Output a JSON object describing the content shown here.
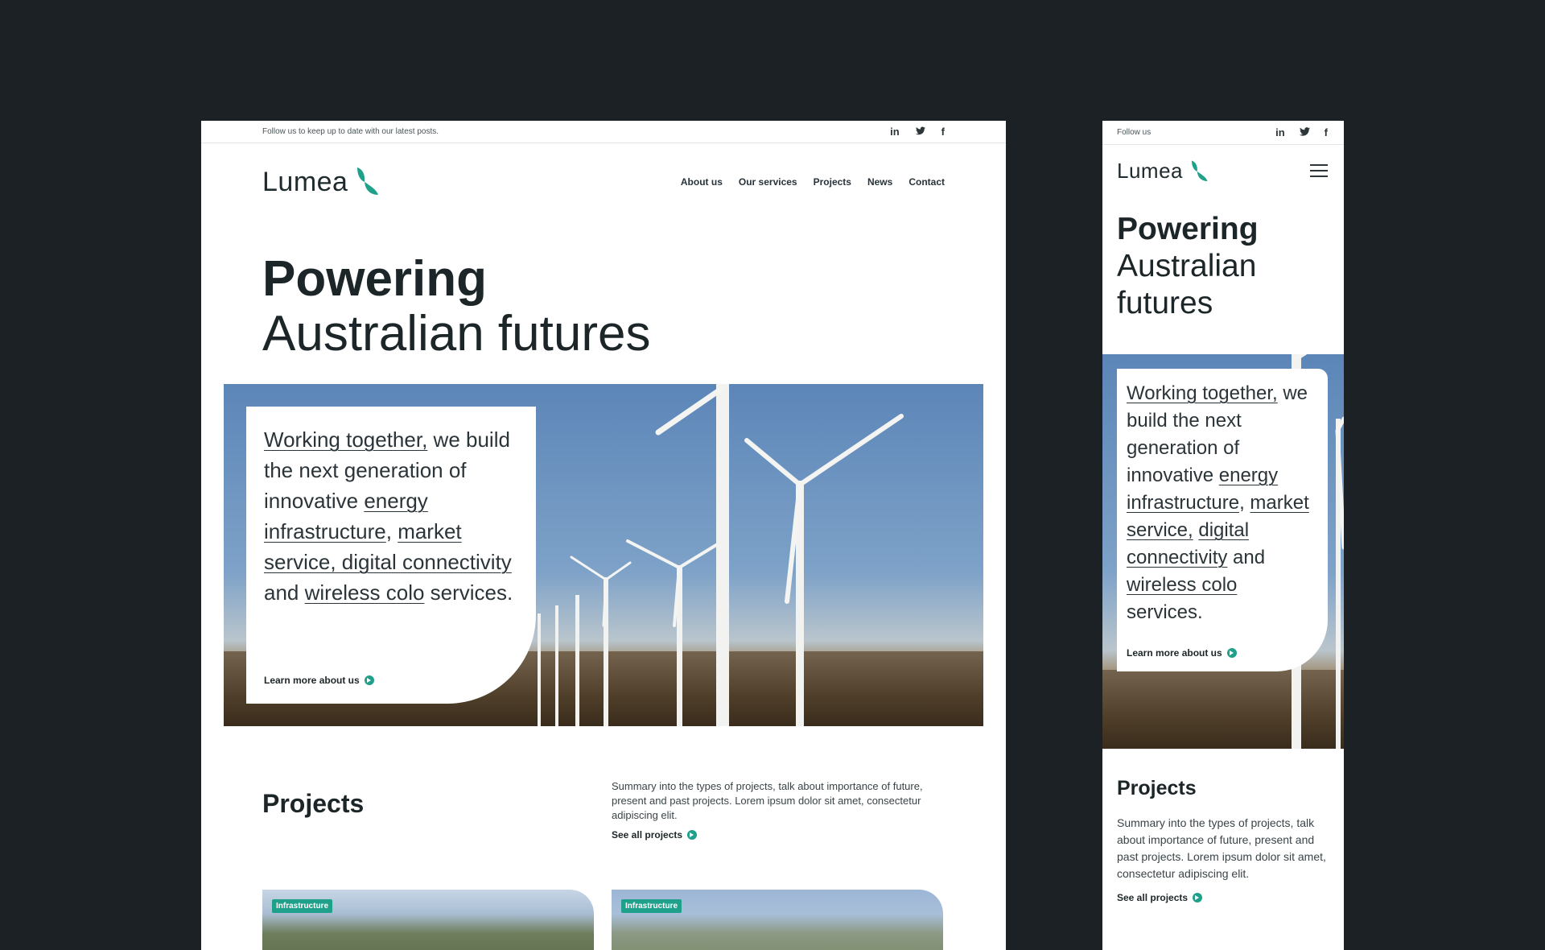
{
  "brand": {
    "name": "Lumea",
    "accent": "#1fa08a",
    "background": "#1b2124"
  },
  "desktop": {
    "topbar": {
      "text": "Follow us to keep up to date with our latest posts."
    },
    "socials": [
      "in",
      "🐦",
      "f"
    ],
    "nav": [
      "About us",
      "Our services",
      "Projects",
      "News",
      "Contact"
    ],
    "hero": {
      "line1": "Powering",
      "line2": "Australian futures"
    },
    "card": {
      "p1": "Working together,",
      "p2": " we build the next generation of innovative ",
      "p3": "energy infrastructure",
      "p4": ", ",
      "p5": "market service, digital connectivity",
      "p6": " and ",
      "p7": "wireless colo",
      "p8": " services.",
      "cta": "Learn more about us"
    },
    "projects": {
      "title": "Projects",
      "summary": "Summary into the types of projects, talk about importance of future, present and past projects. Lorem ipsum dolor sit amet, consectetur adipiscing elit.",
      "cta": "See all projects",
      "cards": [
        {
          "tag": "Infrastructure"
        },
        {
          "tag": "Infrastructure"
        }
      ]
    }
  },
  "mobile": {
    "topbar": {
      "text": "Follow us"
    },
    "hero": {
      "line1": "Powering",
      "line2": "Australian",
      "line3": "futures"
    },
    "card": {
      "p1": "Working together,",
      "p2": " we build the next generation of innovative ",
      "p3": "energy infrastructure",
      "p4": ", ",
      "p5": "market service,",
      "p5b": " ",
      "p5c": "digital connectivity",
      "p6": " and ",
      "p7": "wireless colo",
      "p8": " services.",
      "cta": "Learn more about us"
    },
    "projects": {
      "title": "Projects",
      "summary": "Summary into the types of projects, talk about importance of future, present and past projects. Lorem ipsum dolor sit amet, consectetur adipiscing elit.",
      "cta": "See all projects"
    }
  }
}
